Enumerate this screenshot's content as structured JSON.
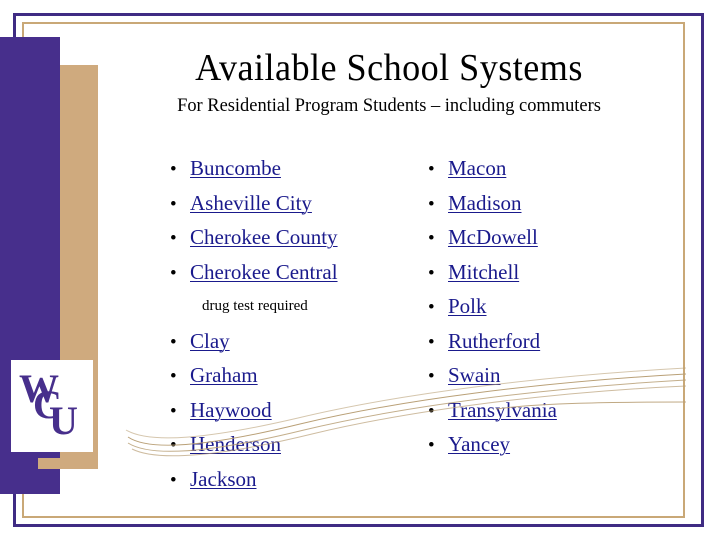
{
  "slide": {
    "title": "Available School Systems",
    "subtitle": "For Residential Program Students – including commuters",
    "logo_text": "WCU"
  },
  "colors": {
    "purple": "#472f8c",
    "tan": "#cfaa7e",
    "border_tan": "#c9a877",
    "border_purple": "#3f2b83",
    "link": "#1a1a8c",
    "text": "#000000",
    "background": "#ffffff"
  },
  "columns": {
    "left": [
      {
        "kind": "link",
        "label": "Buncombe"
      },
      {
        "kind": "link",
        "label": "Asheville City"
      },
      {
        "kind": "link",
        "label": "Cherokee County"
      },
      {
        "kind": "link",
        "label": "Cherokee Central"
      },
      {
        "kind": "note",
        "label": "drug test required"
      },
      {
        "kind": "link",
        "label": "Clay"
      },
      {
        "kind": "link",
        "label": "Graham"
      },
      {
        "kind": "link",
        "label": "Haywood"
      },
      {
        "kind": "link",
        "label": "Henderson"
      },
      {
        "kind": "link",
        "label": "Jackson"
      }
    ],
    "right": [
      {
        "kind": "link",
        "label": "Macon"
      },
      {
        "kind": "link",
        "label": "Madison"
      },
      {
        "kind": "link",
        "label": "McDowell"
      },
      {
        "kind": "link",
        "label": "Mitchell"
      },
      {
        "kind": "link",
        "label": "Polk"
      },
      {
        "kind": "link",
        "label": "Rutherford"
      },
      {
        "kind": "link",
        "label": "Swain"
      },
      {
        "kind": "link",
        "label": "Transylvania"
      },
      {
        "kind": "link",
        "label": "Yancey"
      }
    ]
  },
  "bullet_glyph": "•"
}
